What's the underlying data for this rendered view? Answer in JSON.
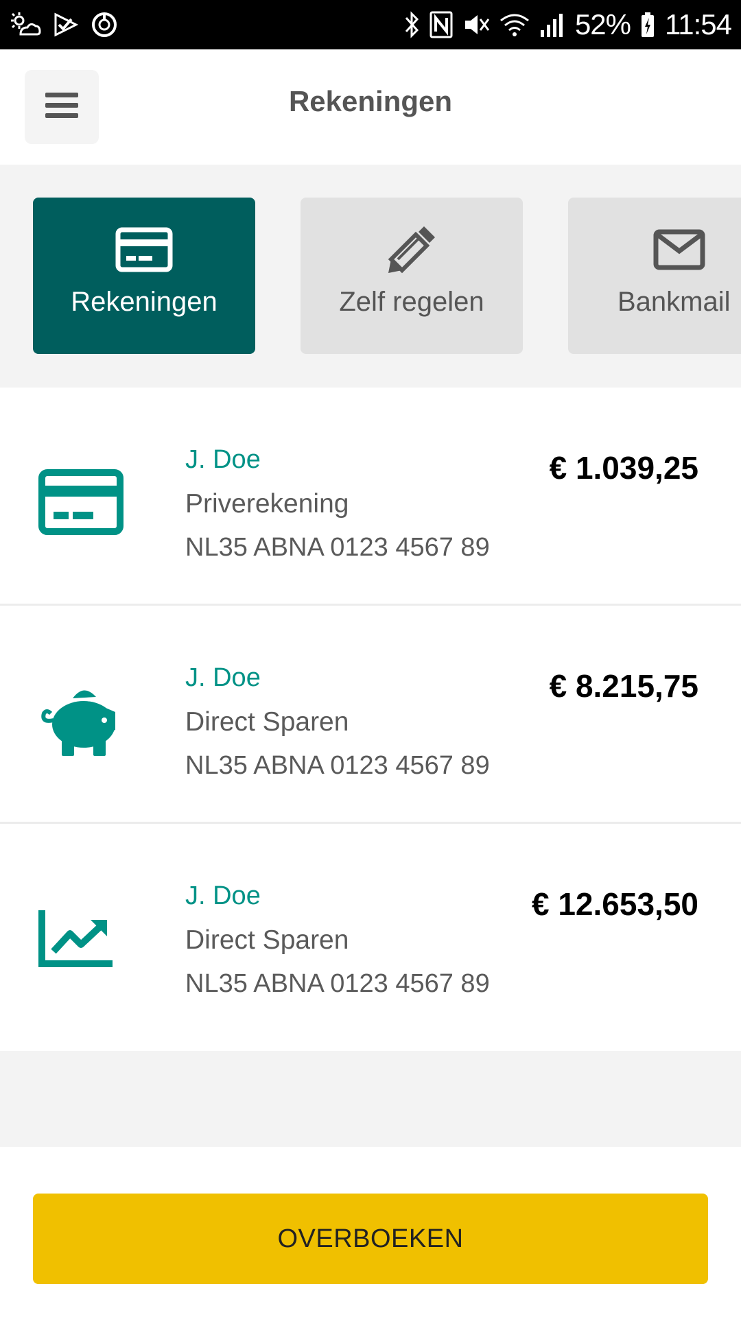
{
  "status_bar": {
    "battery": "52%",
    "time": "11:54"
  },
  "header": {
    "title": "Rekeningen"
  },
  "tabs": [
    {
      "label": "Rekeningen",
      "icon": "credit-card-icon",
      "active": true
    },
    {
      "label": "Zelf regelen",
      "icon": "pencil-icon",
      "active": false
    },
    {
      "label": "Bankmail",
      "icon": "envelope-icon",
      "active": false
    }
  ],
  "accounts": [
    {
      "holder": "J. Doe",
      "type": "Priverekening",
      "iban": "NL35 ABNA 0123 4567 89",
      "balance": "€ 1.039,25",
      "icon": "credit-card-icon"
    },
    {
      "holder": "J. Doe",
      "type": "Direct Sparen",
      "iban": "NL35 ABNA 0123 4567 89",
      "balance": "€ 8.215,75",
      "icon": "piggy-bank-icon"
    },
    {
      "holder": "J. Doe",
      "type": "Direct Sparen",
      "iban": "NL35 ABNA 0123 4567 89",
      "balance": "€ 12.653,50",
      "icon": "chart-line-icon"
    }
  ],
  "actions": {
    "transfer_label": "OVERBOEKEN"
  },
  "colors": {
    "brand_teal": "#005e5d",
    "accent_teal": "#009286",
    "button_yellow": "#f0c000",
    "tab_inactive": "#e1e1e1"
  }
}
